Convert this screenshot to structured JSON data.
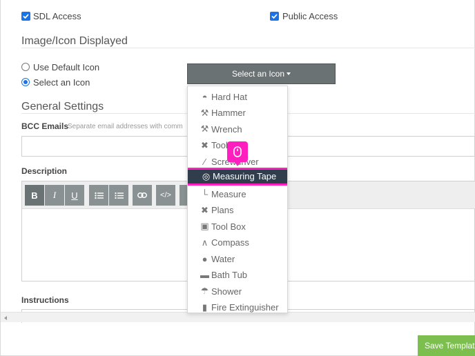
{
  "access": {
    "sdl_label": "SDL Access",
    "sdl_checked": true,
    "public_label": "Public Access",
    "public_checked": true
  },
  "icon_section": {
    "title": "Image/Icon Displayed",
    "options": [
      {
        "label": "Use Default Icon",
        "selected": false
      },
      {
        "label": "Select an Icon",
        "selected": true
      }
    ],
    "select_button_label": "Select an Icon"
  },
  "icon_dropdown": {
    "items": [
      {
        "label": "Hard Hat",
        "icon": "hard-hat-icon"
      },
      {
        "label": "Hammer",
        "icon": "hammer-icon"
      },
      {
        "label": "Wrench",
        "icon": "wrench-icon"
      },
      {
        "label": "Tools",
        "icon": "tools-icon"
      },
      {
        "label": "Screwdriver",
        "icon": "screwdriver-icon"
      },
      {
        "label": "Measuring Tape",
        "icon": "measuring-tape-icon"
      },
      {
        "label": "Measure",
        "icon": "ruler-icon"
      },
      {
        "label": "Plans",
        "icon": "plans-icon"
      },
      {
        "label": "Tool Box",
        "icon": "toolbox-icon"
      },
      {
        "label": "Compass",
        "icon": "compass-icon"
      },
      {
        "label": "Water",
        "icon": "water-drop-icon"
      },
      {
        "label": "Bath Tub",
        "icon": "bath-tub-icon"
      },
      {
        "label": "Shower",
        "icon": "shower-icon"
      },
      {
        "label": "Fire Extinguisher",
        "icon": "fire-extinguisher-icon"
      }
    ],
    "highlighted_index": 5
  },
  "general": {
    "title": "General Settings",
    "bcc_label": "BCC Emails",
    "bcc_hint": "Separate email addresses with comm",
    "bcc_value": "",
    "description_label": "Description",
    "instructions_label": "Instructions"
  },
  "editor_toolbar": {
    "buttons": [
      "B",
      "I",
      "U",
      "bulleted-list-icon",
      "numbered-list-icon",
      "link-icon",
      "</>"
    ]
  },
  "footer": {
    "save_label": "Save Template"
  },
  "colors": {
    "highlight_border": "#ff1fbf",
    "active_item_bg": "#2f3d4c",
    "select_button_bg": "#6b7273",
    "save_button_bg": "#7cbf4e",
    "checkbox_blue": "#1a73e8"
  }
}
